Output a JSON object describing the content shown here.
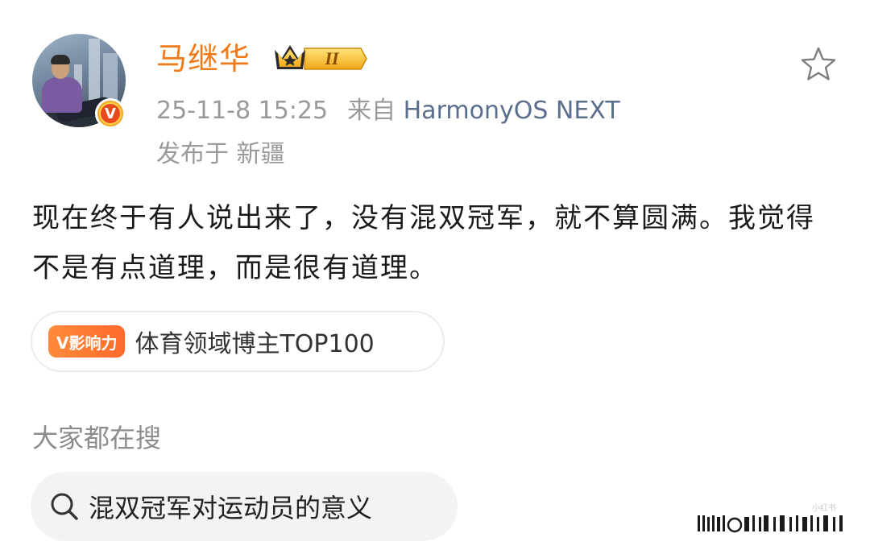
{
  "post": {
    "author": "马继华",
    "level_badge": "II",
    "timestamp": "25-11-8 15:25",
    "source_prefix": "来自",
    "source": "HarmonyOS NEXT",
    "location": "发布于 新疆",
    "avatar_badge": "V",
    "content": "现在终于有人说出来了，没有混双冠军，就不算圆满。我觉得不是有点道理，而是很有道理。"
  },
  "influence": {
    "tag": "V影响力",
    "text": "体育领域博主TOP100"
  },
  "search": {
    "title": "大家都在搜",
    "query": "混双冠军对运动员的意义"
  },
  "watermark": {
    "text": "小红书"
  },
  "colors": {
    "username": "#f07a17",
    "source_link": "#5b6e8c",
    "meta": "#9a9a9a",
    "influence_tag": "#ff7a33"
  },
  "icons": [
    "star-icon",
    "crown-level-icon",
    "verified-v-icon",
    "search-icon"
  ]
}
